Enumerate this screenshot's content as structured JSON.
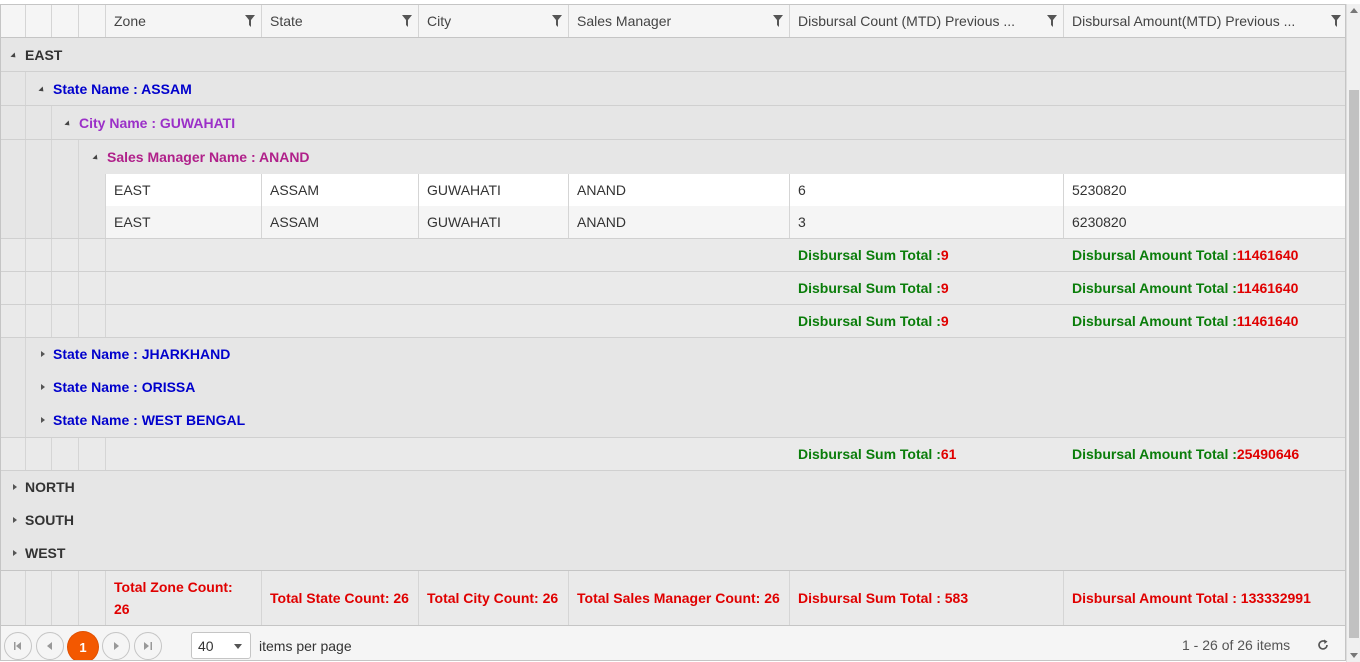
{
  "columns": [
    "Zone",
    "State",
    "City",
    "Sales Manager",
    "Disbursal Count (MTD) Previous ...",
    "Disbursal Amount(MTD) Previous ..."
  ],
  "groups": {
    "east": "EAST",
    "assam": "State Name : ASSAM",
    "guwahati": "City Name : GUWAHATI",
    "anand": "Sales Manager Name : ANAND",
    "jharkhand": "State Name : JHARKHAND",
    "orissa": "State Name : ORISSA",
    "west_bengal": "State Name : WEST BENGAL",
    "north": "NORTH",
    "south": "SOUTH",
    "west": "WEST"
  },
  "rows": [
    {
      "zone": "EAST",
      "state": "ASSAM",
      "city": "GUWAHATI",
      "manager": "ANAND",
      "count": "6",
      "amount": "5230820"
    },
    {
      "zone": "EAST",
      "state": "ASSAM",
      "city": "GUWAHATI",
      "manager": "ANAND",
      "count": "3",
      "amount": "6230820"
    }
  ],
  "labels": {
    "sum_total": "Disbursal Sum Total : ",
    "amount_total": "Disbursal Amount Total : "
  },
  "footers": {
    "anand_sum": "9",
    "anand_amount": "11461640",
    "guwahati_sum": "9",
    "guwahati_amount": "11461640",
    "assam_sum": "9",
    "assam_amount": "11461640",
    "east_sum": "61",
    "east_amount": "25490646"
  },
  "grand_footer": {
    "zone_count": "Total Zone Count: 26",
    "state_count": "Total State Count: 26",
    "city_count": "Total City Count: 26",
    "manager_count": "Total Sales Manager Count: 26",
    "sum_total": "Disbursal Sum Total : 583",
    "amount_total": "Disbursal Amount Total : 133332991"
  },
  "pager": {
    "current_page": "1",
    "page_size": "40",
    "items_per_page": "items per page",
    "info": "1 - 26 of 26 items"
  },
  "icons": [
    "filter-icon",
    "first-page-icon",
    "prev-page-icon",
    "next-page-icon",
    "last-page-icon",
    "refresh-icon",
    "expand-icon",
    "collapse-icon"
  ],
  "colors": {
    "accent": "#f35800",
    "state": "#0000cc",
    "city": "#9b30c8",
    "manager": "#b0208a",
    "label_green": "#0a7d0a",
    "value_red": "#e00000"
  }
}
